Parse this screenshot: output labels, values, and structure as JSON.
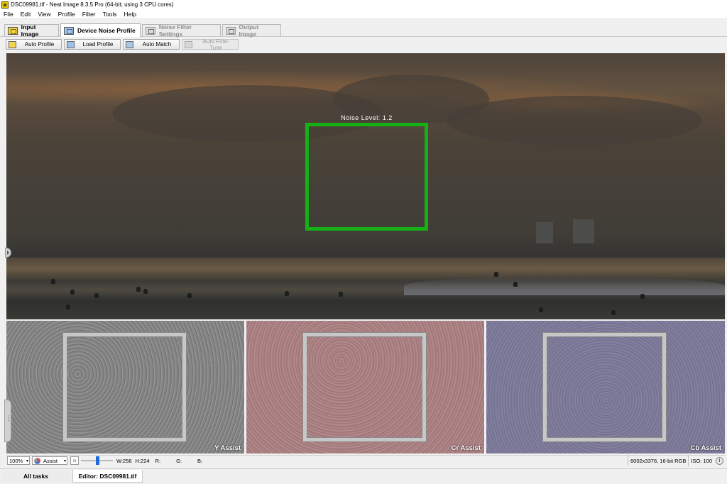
{
  "window": {
    "title": "DSC09981.tif - Neat Image 8.3.5 Pro (64-bit; using 3 CPU cores)"
  },
  "menu": [
    "File",
    "Edit",
    "View",
    "Profile",
    "Filter",
    "Tools",
    "Help"
  ],
  "tabs": [
    {
      "label": "Input Image",
      "icon": "input-image-icon",
      "active": false,
      "enabled": true
    },
    {
      "label": "Device Noise Profile",
      "icon": "noise-profile-icon",
      "active": true,
      "enabled": true
    },
    {
      "label": "Noise Filter Settings",
      "icon": "filter-settings-icon",
      "active": false,
      "enabled": false
    },
    {
      "label": "Output Image",
      "icon": "output-image-icon",
      "active": false,
      "enabled": false
    }
  ],
  "toolbar": {
    "auto_profile": "Auto Profile",
    "load_profile": "Load Profile",
    "auto_match": "Auto Match",
    "auto_fine_tune": "Auto Fine-Tune"
  },
  "preview": {
    "noise_level_label": "Noise Level: 1.2",
    "box_color": "#16b016"
  },
  "assist_panels": [
    {
      "label": "Y Assist",
      "tint": "#808080"
    },
    {
      "label": "Cr Assist",
      "tint": "#a77f82"
    },
    {
      "label": "Cb Assist",
      "tint": "#7d7a99"
    }
  ],
  "status": {
    "zoom": "100%",
    "view_mode": "Assist",
    "width": "W:256",
    "height": "H:224",
    "r": "R:",
    "g": "G:",
    "b": "B:",
    "image_info": "6002x3376, 16-bit RGB",
    "iso": "ISO: 100"
  },
  "bottom_tabs": {
    "all_tasks": "All tasks",
    "editor": "Editor: DSC09981.tif"
  }
}
